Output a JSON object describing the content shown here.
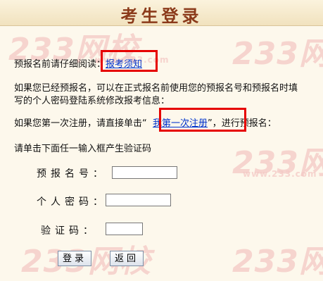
{
  "page": {
    "title": "考生登录"
  },
  "watermark": {
    "text": "233网校",
    "subtext": "www.233.com"
  },
  "notice": {
    "before": "预报名前请仔细阅读：",
    "link": "报考须知"
  },
  "registered": {
    "line1": "如果您已经预报名，可以在正式报名前使用您的预报名号和预报名时填",
    "line2": "写的个人密码登陆系统修改报考信息："
  },
  "first_time": {
    "before": "如果您第一次注册，请直接单击“",
    "link": "我第一次注册",
    "after": "”，进行预报名："
  },
  "captcha_hint": "请单击下面任一输入框产生验证码",
  "form": {
    "reg_no_label": "预报名号：",
    "reg_no_value": "",
    "password_label": "个人密码：",
    "password_value": "",
    "captcha_label": "验证码：",
    "captcha_value": ""
  },
  "buttons": {
    "login": "登录",
    "back": "返回"
  },
  "colors": {
    "highlight": "#E60000",
    "title": "#8B3A1A",
    "link": "#0033CC"
  }
}
